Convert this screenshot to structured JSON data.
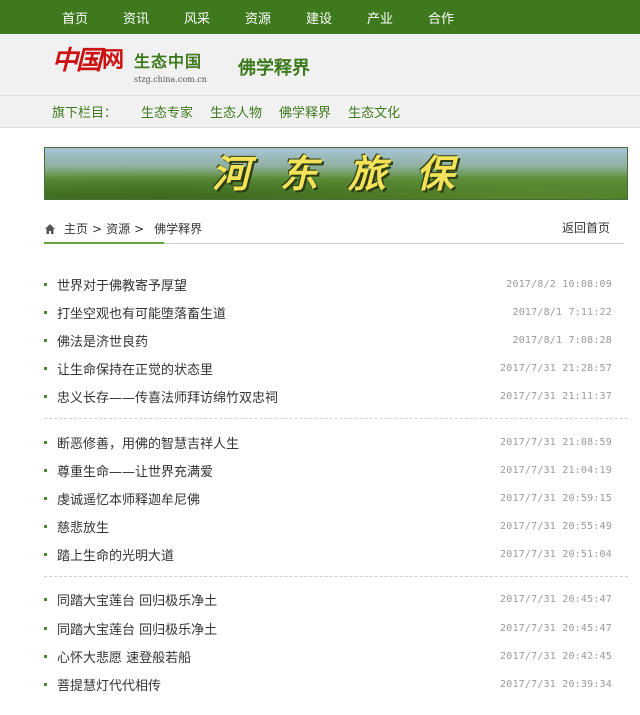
{
  "topnav": [
    "首页",
    "资讯",
    "风采",
    "资源",
    "建设",
    "产业",
    "合作"
  ],
  "header": {
    "logo_cn": "中国",
    "logo_wang": "网",
    "site_name": "生态中国",
    "site_url": "stzg.china.com.cn",
    "section_title": "佛学释界"
  },
  "subnav": {
    "lead": "旗下栏目：",
    "items": [
      "生态专家",
      "生态人物",
      "佛学释界",
      "生态文化"
    ]
  },
  "banner": {
    "text": "河东旅保"
  },
  "breadcrumb": {
    "home": "主页",
    "sep1": ">",
    "level1": "资源",
    "sep2": ">",
    "current": "佛学释界",
    "back": "返回首页"
  },
  "groups": [
    [
      {
        "title": "世界对于佛教寄予厚望",
        "date": "2017/8/2 10:08:09"
      },
      {
        "title": "打坐空观也有可能堕落畜生道",
        "date": "2017/8/1 7:11:22"
      },
      {
        "title": "佛法是济世良药",
        "date": "2017/8/1 7:08:28"
      },
      {
        "title": "让生命保持在正觉的状态里",
        "date": "2017/7/31 21:28:57"
      },
      {
        "title": "忠义长存——传喜法师拜访绵竹双忠祠",
        "date": "2017/7/31 21:11:37"
      }
    ],
    [
      {
        "title": "断恶修善，用佛的智慧吉祥人生",
        "date": "2017/7/31 21:08:59"
      },
      {
        "title": "尊重生命——让世界充满爱",
        "date": "2017/7/31 21:04:19"
      },
      {
        "title": "虔诚遥忆本师释迦牟尼佛",
        "date": "2017/7/31 20:59:15"
      },
      {
        "title": "慈悲放生",
        "date": "2017/7/31 20:55:49"
      },
      {
        "title": "踏上生命的光明大道",
        "date": "2017/7/31 20:51:04"
      }
    ],
    [
      {
        "title": "同踏大宝莲台 回归极乐净土",
        "date": "2017/7/31 20:45:47"
      },
      {
        "title": "同踏大宝莲台 回归极乐净土",
        "date": "2017/7/31 20:45:47"
      },
      {
        "title": "心怀大悲愿 速登般若船",
        "date": "2017/7/31 20:42:45"
      },
      {
        "title": "菩提慧灯代代相传",
        "date": "2017/7/31 20:39:34"
      }
    ]
  ]
}
